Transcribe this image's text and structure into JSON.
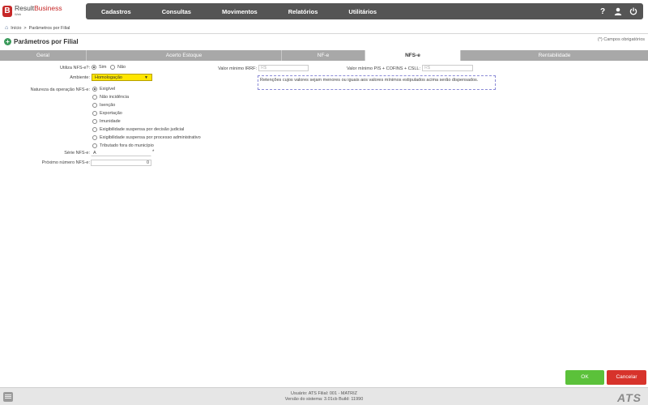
{
  "app": {
    "logo_letter": "B",
    "brand_part1": "Result",
    "brand_part2": "Business",
    "brand_sub": "Web"
  },
  "menu": [
    "Cadastros",
    "Consultas",
    "Movimentos",
    "Relatórios",
    "Utilitários"
  ],
  "top_icons": [
    "help-icon",
    "user-icon",
    "power-icon"
  ],
  "breadcrumb": {
    "home": "Início",
    "separator": ">",
    "current": "Parâmetros por Filial"
  },
  "page": {
    "title": "Parâmetros por Filial",
    "required_note": "(*) Campos obrigatórios"
  },
  "tabs": [
    "Geral",
    "Acerto Estoque",
    "NF-e",
    "NFS-e",
    "Rentabilidade"
  ],
  "active_tab": "NFS-e",
  "form": {
    "utiliza_label": "Utiliza NFS-e?:",
    "utiliza_options": [
      "Sim",
      "Não"
    ],
    "utiliza_selected": "Sim",
    "ambiente_label": "Ambiente:",
    "ambiente_value": "Homologação",
    "natureza_label": "Natureza da operação NFS-e:",
    "natureza_options": [
      "Exigível",
      "Não incidência",
      "Isenção",
      "Exportação",
      "Imunidade",
      "Exigibilidade suspensa por decisão judicial",
      "Exigibilidade suspensa por processo administrativo",
      "Tributado fora do município"
    ],
    "natureza_selected": "Exigível",
    "serie_label": "Série NFS-e:",
    "serie_value": "A",
    "serie_required": "*",
    "proximo_label": "Próximo número NFS-e:",
    "proximo_value": "0",
    "irrf_label": "Valor mínimo IRRF:",
    "irrf_placeholder": "R$",
    "pis_label": "Valor mínimo PIS + COFINS + CSLL:",
    "pis_placeholder": "R$",
    "note": "Retenções cujos valores sejam menores ou iguais aos valores mínimos estipulados acima serão dispensados."
  },
  "buttons": {
    "ok": "OK",
    "cancel": "Cancelar"
  },
  "footer": {
    "line1": "Usuário: ATS   Filial: 001 - MATRIZ",
    "line2": "Versão do sistema: 3.01cb   Build: 11990",
    "brand": "ATS"
  }
}
